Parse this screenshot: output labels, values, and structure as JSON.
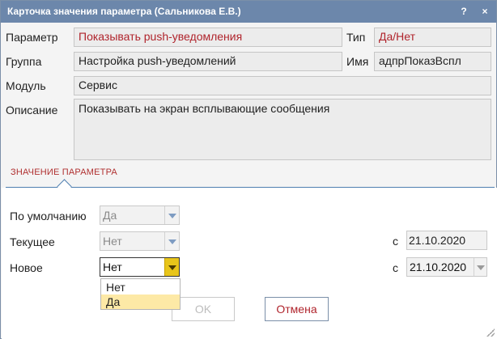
{
  "window": {
    "title": "Карточка значения параметра (Сальникова Е.В.)",
    "help_label": "?",
    "close_label": "×"
  },
  "info": {
    "parameter_label": "Параметр",
    "parameter_value": "Показывать push-уведомления",
    "type_label": "Тип",
    "type_value": "Да/Нет",
    "group_label": "Группа",
    "group_value": "Настройка push-уведомлений",
    "name_label": "Имя",
    "name_value": "адпрПоказВспл",
    "module_label": "Модуль",
    "module_value": "Сервис",
    "description_label": "Описание",
    "description_value": "Показывать на экран всплывающие сообщения"
  },
  "section": {
    "title": "ЗНАЧЕНИЕ ПАРАМЕТРА"
  },
  "values": {
    "default_label": "По умолчанию",
    "default_value": "Да",
    "current_label": "Текущее",
    "current_value": "Нет",
    "current_date_prefix": "с",
    "current_date": "21.10.2020",
    "new_label": "Новое",
    "new_value": "Нет",
    "new_date_prefix": "с",
    "new_date": "21.10.2020"
  },
  "dropdown": {
    "options": [
      "Нет",
      "Да"
    ],
    "highlighted": "Да"
  },
  "buttons": {
    "ok_label": "OK",
    "cancel_label": "Отмена"
  },
  "colors": {
    "titlebar": "#6c87ab",
    "accent_red": "#b0242c",
    "section_line": "#4f7fb0",
    "dropdown_arrow_active": "#e8c51a",
    "dropdown_highlight": "#fde9a6"
  }
}
